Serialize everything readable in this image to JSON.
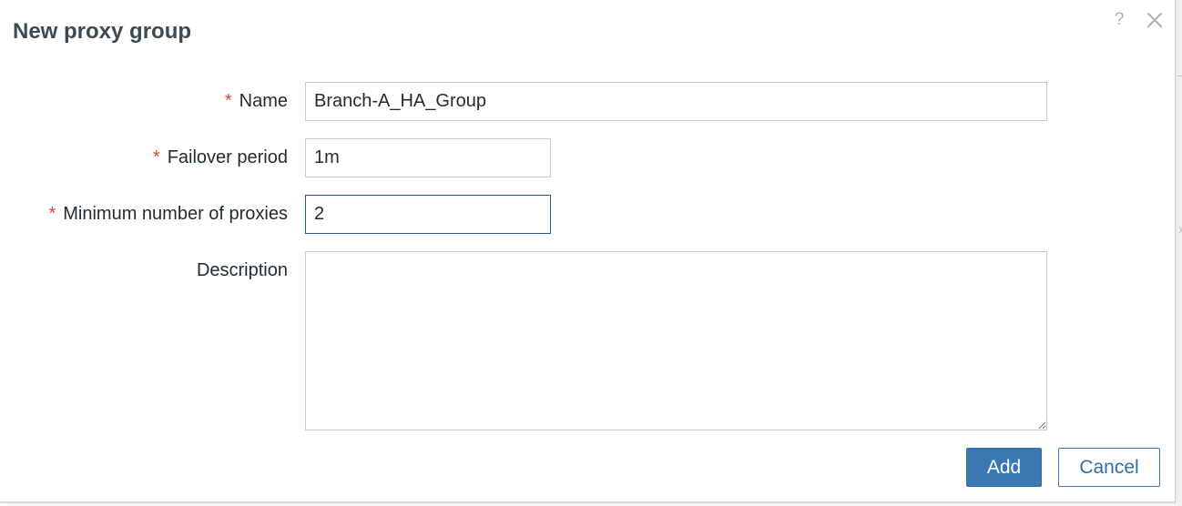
{
  "dialog": {
    "title": "New proxy group",
    "help_glyph": "?",
    "close_icon": "close-icon"
  },
  "form": {
    "name": {
      "required_mark": "*",
      "label": "Name",
      "value": "Branch-A_HA_Group"
    },
    "failover_period": {
      "required_mark": "*",
      "label": "Failover period",
      "value": "1m"
    },
    "min_proxies": {
      "required_mark": "*",
      "label": "Minimum number of proxies",
      "value": "2"
    },
    "description": {
      "label": "Description",
      "value": ""
    }
  },
  "buttons": {
    "add": "Add",
    "cancel": "Cancel"
  },
  "colors": {
    "primary": "#3b78b2",
    "required": "#d64541",
    "focus_border": "#2c5b86"
  }
}
